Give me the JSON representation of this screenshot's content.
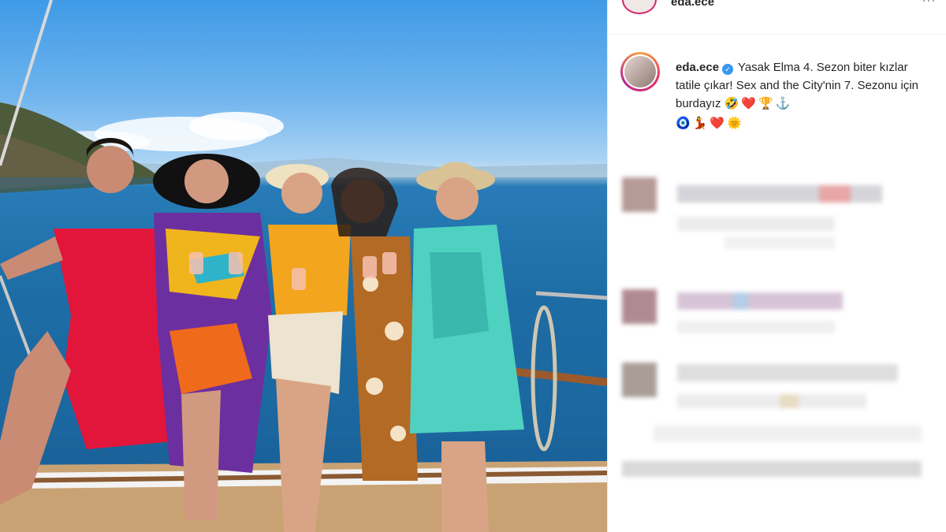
{
  "post": {
    "username": "eda.ece",
    "verified_mark": "✓",
    "caption": "Yasak Elma 4. Sezon biter kızlar tatile çıkar! Sex and the City'nin 7. Sezonu için burdayız",
    "caption_emojis_line1": [
      "🤣",
      "❤️",
      "🏆",
      "⚓"
    ],
    "caption_emojis_line2": [
      "🧿",
      "💃",
      "❤️",
      "🌞"
    ]
  },
  "header": {
    "username": "eda.ece",
    "more_label": "···"
  },
  "colors": {
    "verified": "#3897f0",
    "ring": "#d6246e",
    "text": "#262626"
  }
}
